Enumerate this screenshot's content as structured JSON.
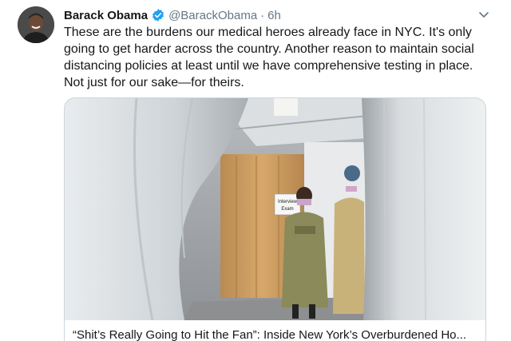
{
  "tweet": {
    "author_name": "Barack Obama",
    "handle": "@BarackObama",
    "separator": "·",
    "time": "6h",
    "text": "These are the burdens our medical heroes already face in NYC. It's only going to get harder across the country. Another reason to maintain social distancing policies at least until we have comprehensive testing in place. Not just for our sake—for theirs."
  },
  "card": {
    "title": "“Shit’s Really Going to Hit the Fan”: Inside New York’s Overburdened Ho...",
    "sign_text_line1": "Interview",
    "sign_text_line2": "Exam"
  },
  "colors": {
    "verified": "#1da1f2",
    "muted": "#657786",
    "text": "#14171a",
    "border": "#ccd6dd"
  },
  "icons": {
    "verified": "verified-badge-icon",
    "menu": "chevron-down-icon"
  }
}
